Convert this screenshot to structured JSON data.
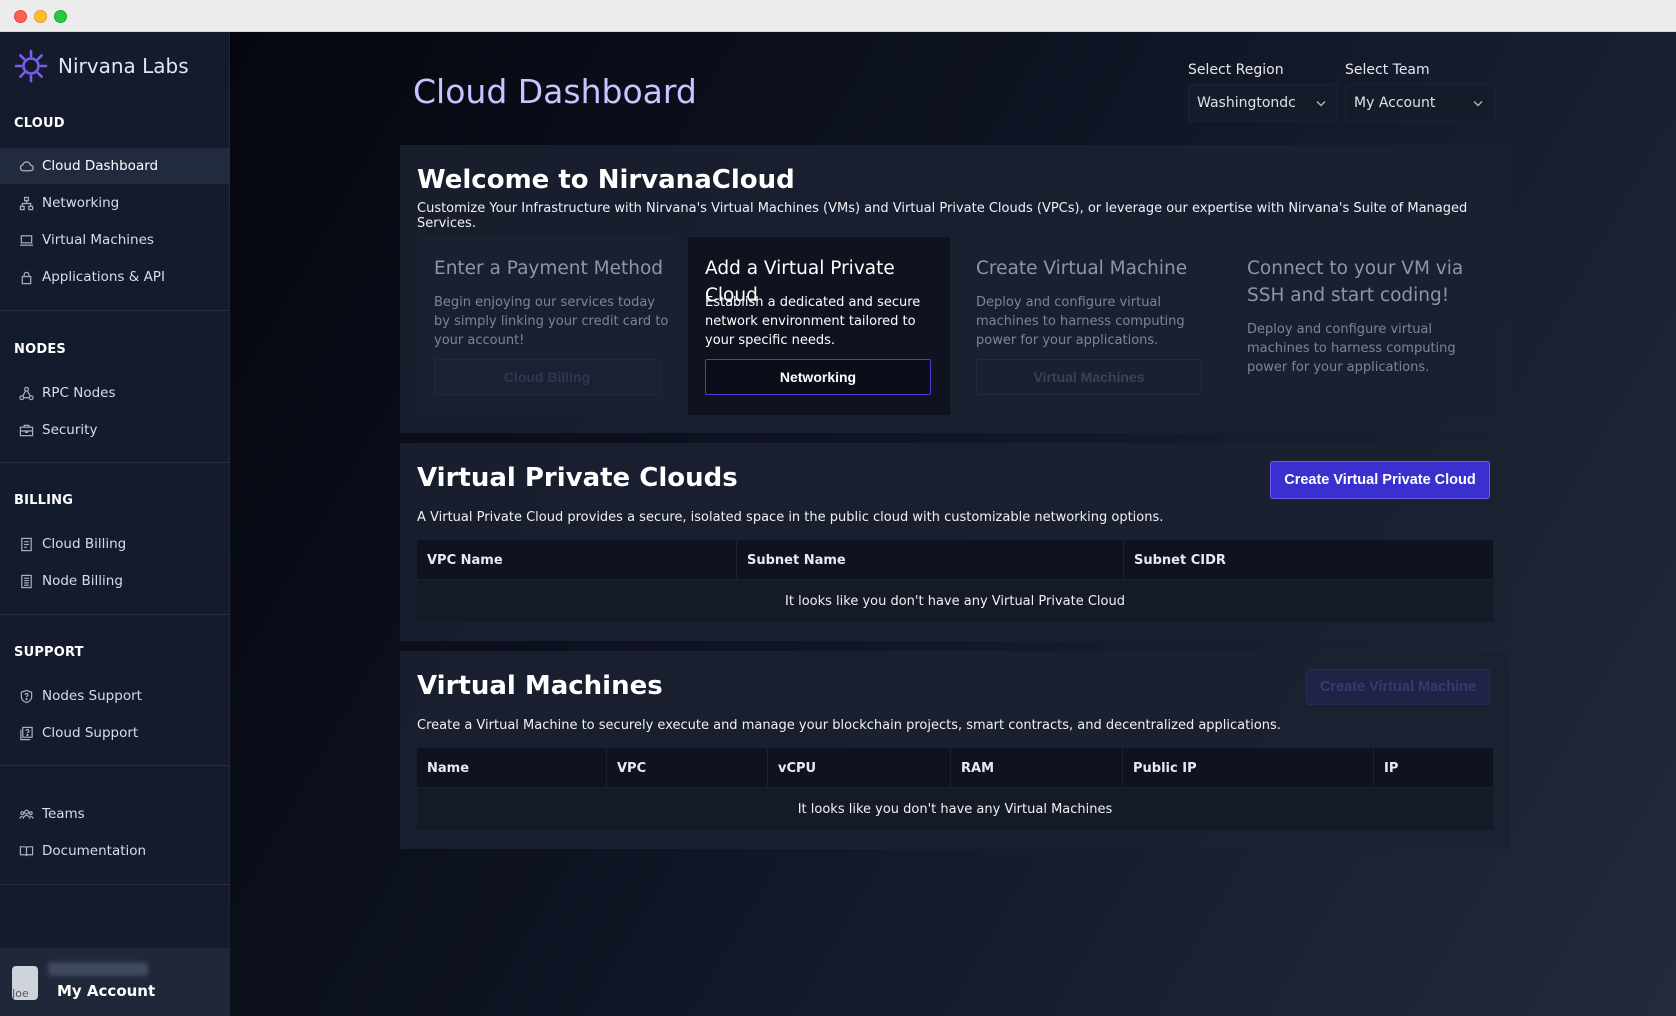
{
  "window": {
    "controls": [
      "close",
      "minimize",
      "maximize"
    ]
  },
  "brand": {
    "name": "Nirvana Labs",
    "logo_icon": "nirvana-sun-icon",
    "accent": "#7b5cf0"
  },
  "sidebar": {
    "sections": [
      {
        "title": "CLOUD",
        "items": [
          {
            "label": "Cloud Dashboard",
            "icon": "cloud-icon",
            "active": true
          },
          {
            "label": "Networking",
            "icon": "network-icon"
          },
          {
            "label": "Virtual Machines",
            "icon": "laptop-icon"
          },
          {
            "label": "Applications & API",
            "icon": "lock-icon"
          }
        ]
      },
      {
        "title": "NODES",
        "items": [
          {
            "label": "RPC Nodes",
            "icon": "nodes-icon"
          },
          {
            "label": "Security",
            "icon": "briefcase-icon"
          }
        ]
      },
      {
        "title": "BILLING",
        "items": [
          {
            "label": "Cloud Billing",
            "icon": "receipt-icon"
          },
          {
            "label": "Node Billing",
            "icon": "document-icon"
          }
        ]
      },
      {
        "title": "SUPPORT",
        "items": [
          {
            "label": "Nodes Support",
            "icon": "help-shield-icon"
          },
          {
            "label": "Cloud Support",
            "icon": "help-pages-icon"
          }
        ]
      },
      {
        "title": "",
        "items": [
          {
            "label": "Teams",
            "icon": "team-icon"
          },
          {
            "label": "Documentation",
            "icon": "book-icon"
          }
        ]
      }
    ],
    "account": {
      "label": "My Account",
      "avatar_alt": "Joe"
    }
  },
  "header": {
    "title": "Cloud Dashboard",
    "region": {
      "label": "Select Region",
      "value": "Washingtondc"
    },
    "team": {
      "label": "Select Team",
      "value": "My Account"
    }
  },
  "welcome": {
    "title": "Welcome to NirvanaCloud",
    "description": "Customize Your Infrastructure with Nirvana's Virtual Machines (VMs) and Virtual Private Clouds (VPCs), or leverage our expertise with Nirvana's Suite of Managed Services.",
    "cards": [
      {
        "title": "Enter a Payment Method",
        "description": "Begin enjoying our services today by simply linking your credit card to your account!",
        "button": "Cloud Billing"
      },
      {
        "title": "Add a Virtual Private Cloud",
        "description": "Establish a dedicated and secure network environment tailored to your specific needs.",
        "button": "Networking"
      },
      {
        "title": "Create Virtual Machine",
        "description": "Deploy and configure virtual machines to harness computing power for your applications.",
        "button": "Virtual Machines"
      },
      {
        "title": "Connect to your VM via SSH and start coding!",
        "description": "Deploy and configure virtual machines to harness computing power for your applications."
      }
    ]
  },
  "vpc": {
    "title": "Virtual Private Clouds",
    "description": "A Virtual Private Cloud provides a secure, isolated space in the public cloud with customizable networking options.",
    "create_button": "Create Virtual Private Cloud",
    "columns": [
      "VPC Name",
      "Subnet Name",
      "Subnet CIDR"
    ],
    "empty": "It looks like you don't have any Virtual Private Cloud"
  },
  "vms": {
    "title": "Virtual Machines",
    "description": "Create a Virtual Machine to securely execute and manage your blockchain projects, smart contracts, and decentralized applications.",
    "create_button": "Create Virtual Machine",
    "columns": [
      "Name",
      "VPC",
      "vCPU",
      "RAM",
      "Public IP",
      "IP"
    ],
    "empty": "It looks like you don't have any Virtual Machines"
  }
}
